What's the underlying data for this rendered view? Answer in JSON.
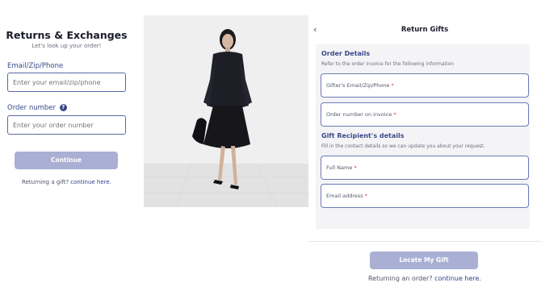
{
  "left": {
    "title": "Returns & Exchanges",
    "subtitle": "Let's look up your order!",
    "email_label": "Email/Zip/Phone",
    "email_placeholder": "Enter your email/zip/phone",
    "order_label": "Order number",
    "order_placeholder": "Enter your order number",
    "help_icon": "?",
    "continue_label": "Continue",
    "gift_prefix": "Returning a gift?",
    "gift_link": "continue here."
  },
  "photo": {
    "icon": "fashion-model-photo",
    "alt_colors": {
      "coat": "#1c1d24",
      "background": "#eeeeee",
      "floor": "#e3e3e3"
    }
  },
  "right": {
    "back_icon": "‹",
    "title": "Return Gifts",
    "order_section": "Order Details",
    "order_hint": "Refer to the order invoice for the following information",
    "gifter_field": "Gifter's Email/Zip/Phone",
    "invoice_field": "Order number on invoice",
    "recipient_section": "Gift Recipient's details",
    "recipient_hint": "Fill in the contact details so we can update you about your request.",
    "name_field": "Full Name",
    "email_field": "Email address",
    "required_mark": "*",
    "locate_label": "Locate My Gift",
    "return_prefix": "Returning an order?",
    "return_link": "continue here."
  },
  "colors": {
    "accent": "#3a4a8a",
    "button_disabled": "#a9b0d4",
    "link": "#2e3f8f",
    "required": "#d23a3a"
  }
}
